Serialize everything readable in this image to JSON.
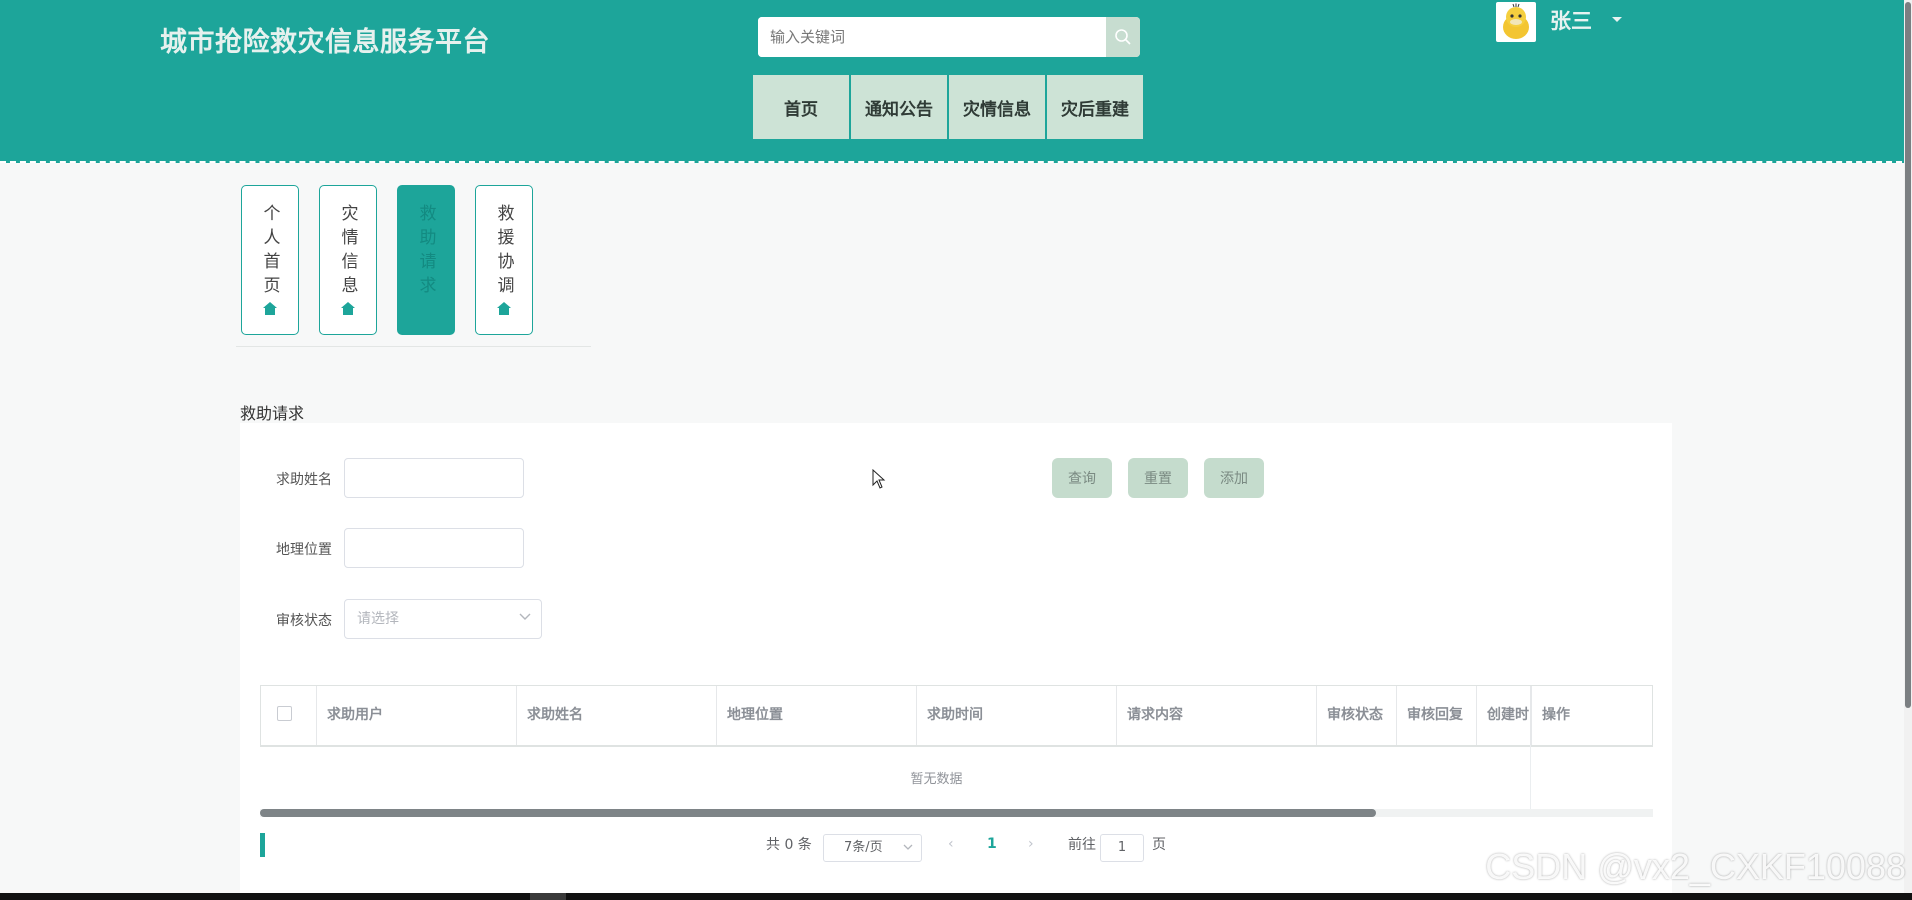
{
  "header": {
    "brand": "城市抢险救灾信息服务平台",
    "search_placeholder": "输入关键词",
    "nav": [
      "首页",
      "通知公告",
      "灾情信息",
      "灾后重建"
    ],
    "user_name": "张三"
  },
  "side_tabs": [
    {
      "label": "个人首页",
      "active": false
    },
    {
      "label": "灾情信息",
      "active": false
    },
    {
      "label": "救助请求",
      "active": true
    },
    {
      "label": "救援协调",
      "active": false
    }
  ],
  "page": {
    "title": "救助请求",
    "filters": {
      "name_label": "求助姓名",
      "location_label": "地理位置",
      "status_label": "审核状态",
      "status_placeholder": "请选择"
    },
    "buttons": {
      "query": "查询",
      "reset": "重置",
      "add": "添加"
    },
    "table": {
      "columns": [
        "求助用户",
        "求助姓名",
        "地理位置",
        "求助时间",
        "请求内容",
        "审核状态",
        "审核回复",
        "创建时间",
        "操作"
      ],
      "empty_text": "暂无数据"
    },
    "pagination": {
      "total": "共 0 条",
      "page_size": "7条/页",
      "current_page": "1",
      "goto_label": "前往",
      "goto_value": "1",
      "page_suffix": "页"
    }
  },
  "watermark": "CSDN @vx2_CXKF10088",
  "colors": {
    "primary": "#1da59a",
    "nav_bg": "#cde3d6",
    "button_bg": "#c5dccd"
  }
}
